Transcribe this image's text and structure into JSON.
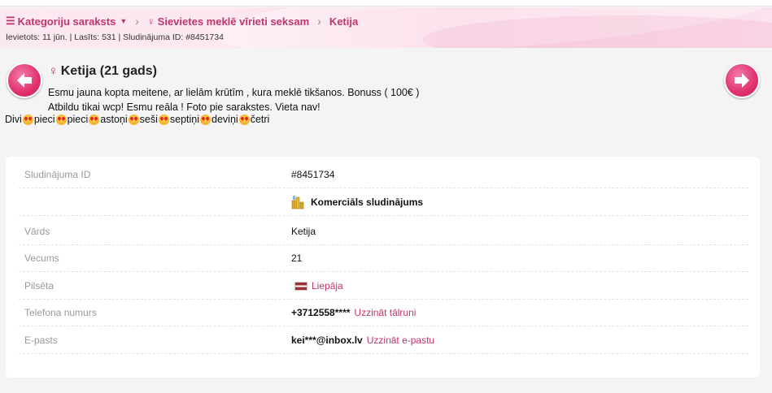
{
  "breadcrumb": {
    "categories": "Kategoriju saraksts",
    "section": "Sievietes meklē vīrieti seksam",
    "current": "Ketija"
  },
  "meta": "Ievietots: 11 jūn. | Lasīts: 531 | Sludinājuma ID: #8451734",
  "listing": {
    "title": "Ketija (21 gads)",
    "line1": "Esmu jauna kopta meitene, ar lielām krūtīm , kura meklē tikšanos. Bonuss ( 100€ )",
    "line2": "Atbildu tikai wcp! Esmu reāla ! Foto pie sarakstes. Vieta nav!",
    "line3_words": [
      "Divi",
      "pieci",
      "pieci",
      "astoņi",
      "seši",
      "septiņi",
      "deviņi",
      "četri"
    ]
  },
  "details": {
    "id_label": "Sludinājuma ID",
    "id_value": "#8451734",
    "commercial": "Komerciāls sludinājums",
    "name_label": "Vārds",
    "name_value": "Ketija",
    "age_label": "Vecums",
    "age_value": "21",
    "city_label": "Pilsēta",
    "city_value": "Liepāja",
    "phone_label": "Telefona numurs",
    "phone_value": "+3712558****",
    "phone_link": "Uzzināt tālruni",
    "email_label": "E-pasts",
    "email_value": "kei***@inbox.lv",
    "email_link": "Uzzināt e-pastu"
  },
  "colors": {
    "accent": "#c0356f",
    "button": "#e0326f"
  }
}
